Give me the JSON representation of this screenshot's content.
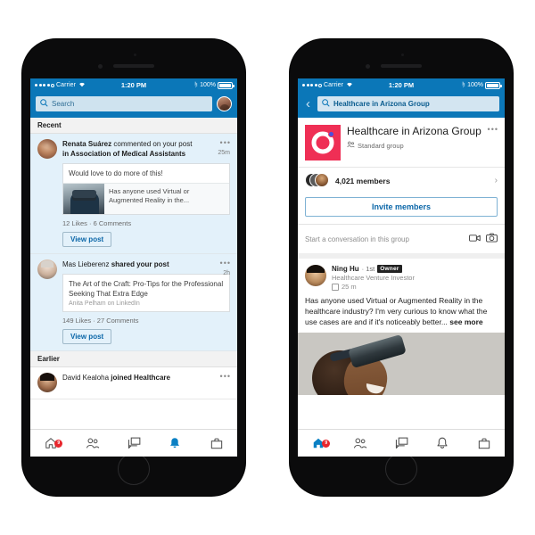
{
  "statusbar": {
    "carrier": "Carrier",
    "time": "1:20 PM",
    "battery": "100%"
  },
  "left_phone": {
    "search": {
      "placeholder": "Search",
      "icon": "search-icon"
    },
    "sections": [
      {
        "header": "Recent",
        "notifications": [
          {
            "actor": "Renata Suárez",
            "action": "commented on your post",
            "action2": "in Association of Medical Assistants",
            "time": "25m",
            "comment": "Would love to do more of this!",
            "card_text": "Has anyone used Virtual or Augmented Reality in the...",
            "stats": "12 Likes  ·  6 Comments",
            "cta": "View post",
            "unread": true
          },
          {
            "actor": "Mas Lieberenz",
            "action": "shared your post",
            "time": "2h",
            "card_title": "The Art of the Craft: Pro-Tips for the Professional Seeking That Extra Edge",
            "card_source": "Anita Pelham on LinkedIn",
            "stats": "149 Likes  ·  27 Comments",
            "cta": "View post",
            "unread": true
          }
        ]
      },
      {
        "header": "Earlier",
        "notifications": [
          {
            "actor": "David Kealoha",
            "action": "joined Healthcare",
            "unread": false
          }
        ]
      }
    ],
    "tabs": [
      {
        "name": "home",
        "label": "Home",
        "active": false,
        "badge": "9"
      },
      {
        "name": "network",
        "label": "My Network",
        "active": false
      },
      {
        "name": "messaging",
        "label": "Messaging",
        "active": false
      },
      {
        "name": "notifications",
        "label": "Notifications",
        "active": true
      },
      {
        "name": "jobs",
        "label": "Jobs",
        "active": false
      }
    ]
  },
  "right_phone": {
    "search": {
      "value": "Healthcare in Arizona Group",
      "icon": "search-icon"
    },
    "back_icon": "back-chevron-icon",
    "group": {
      "name": "Healthcare in Arizona Group",
      "type": "Standard group",
      "members_count": "4,021 members",
      "invite_label": "Invite members",
      "composer_placeholder": "Start a conversation in this group",
      "composer_icons": [
        "video-icon",
        "camera-icon"
      ]
    },
    "post": {
      "author": "Ning Hu",
      "degree": "· 1st",
      "badge": "Owner",
      "headline": "Healthcare Venture Investor",
      "time": "25 m",
      "text": "Has anyone used Virtual or Augmented Reality in the healthcare industry? I'm very curious to know what the use cases are and if it's noticeably better...",
      "see_more": "see more"
    },
    "tabs": [
      {
        "name": "home",
        "label": "Home",
        "active": true,
        "badge": "9"
      },
      {
        "name": "network",
        "label": "My Network",
        "active": false
      },
      {
        "name": "messaging",
        "label": "Messaging",
        "active": false
      },
      {
        "name": "notifications",
        "label": "Notifications",
        "active": false
      },
      {
        "name": "jobs",
        "label": "Jobs",
        "active": false
      }
    ]
  },
  "colors": {
    "brand_blue": "#0b77b8",
    "unread_blue": "#e3f1fa",
    "link_blue": "#0a66a8",
    "badge_red": "#e8262d",
    "group_pink": "#ef2f55"
  }
}
